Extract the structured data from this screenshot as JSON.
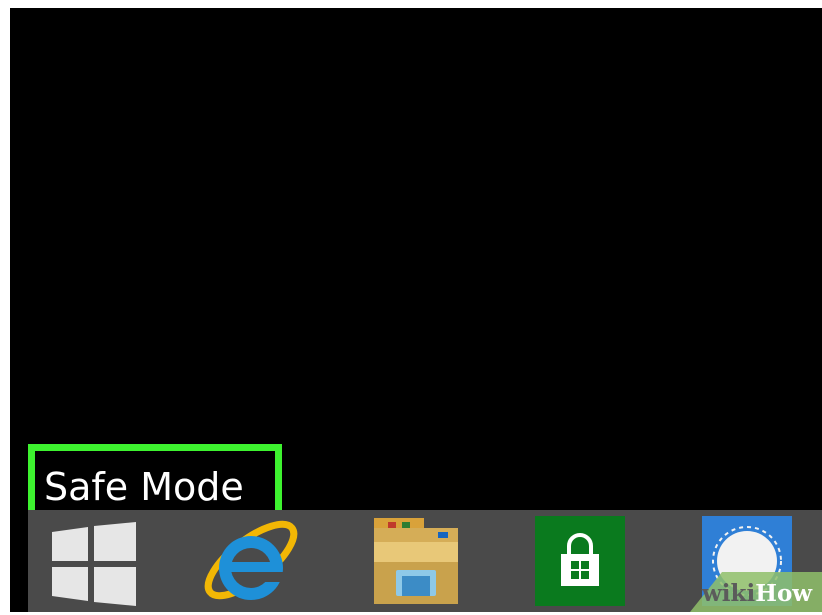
{
  "screen": {
    "safe_mode_label": "Safe Mode",
    "desktop_color": "#000000"
  },
  "highlight": {
    "color": "#3df22f"
  },
  "taskbar": {
    "background": "#4a4a4a",
    "items": [
      {
        "name": "Start",
        "icon": "windows-logo-icon"
      },
      {
        "name": "Internet Explorer",
        "icon": "internet-explorer-icon"
      },
      {
        "name": "File Explorer",
        "icon": "file-explorer-icon"
      },
      {
        "name": "Store",
        "icon": "store-icon"
      },
      {
        "name": "Signal",
        "icon": "signal-icon"
      }
    ]
  },
  "watermark": {
    "part1": "wiki",
    "part2": "How"
  }
}
